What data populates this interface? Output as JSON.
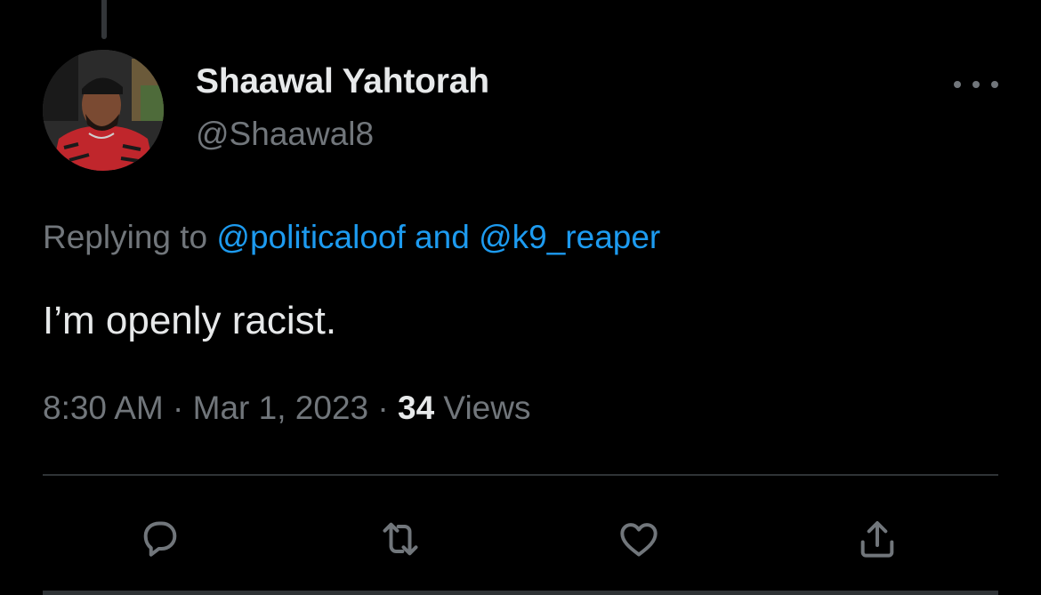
{
  "author": {
    "display_name": "Shaawal Yahtorah",
    "handle": "@Shaawal8"
  },
  "reply_context": {
    "prefix": "Replying to ",
    "mention_1": "@politicaloof",
    "joiner": " and ",
    "mention_2": "@k9_reaper"
  },
  "tweet": {
    "text": "I’m openly racist."
  },
  "meta": {
    "time": "8:30 AM",
    "separator_1": " · ",
    "date": "Mar 1, 2023",
    "separator_2": " · ",
    "views_count": "34",
    "views_label": " Views"
  },
  "icons": {
    "more": "more-horizontal-icon",
    "reply": "reply-bubble-icon",
    "retweet": "retweet-icon",
    "like": "heart-icon",
    "share": "share-upload-icon"
  },
  "colors": {
    "background": "#000000",
    "primary_text": "#e7e9ea",
    "secondary_text": "#71767b",
    "link": "#1d9bf0",
    "divider": "#2f3336"
  }
}
